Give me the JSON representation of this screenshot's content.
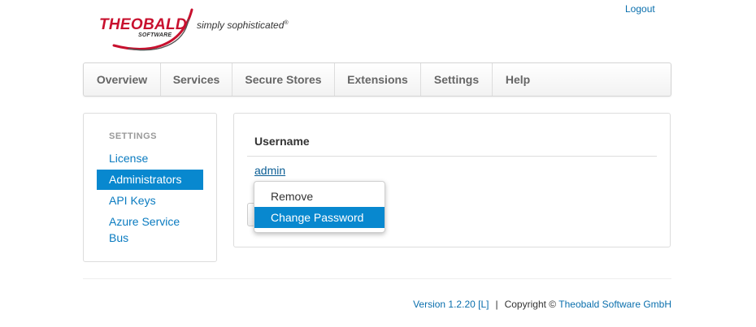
{
  "header": {
    "logo_word": "THEOBALD",
    "logo_sub": "SOFTWARE",
    "tagline": "simply sophisticated",
    "tagline_mark": "®",
    "logout_label": "Logout"
  },
  "nav": {
    "items": [
      {
        "label": "Overview"
      },
      {
        "label": "Services"
      },
      {
        "label": "Secure Stores"
      },
      {
        "label": "Extensions"
      },
      {
        "label": "Settings"
      },
      {
        "label": "Help"
      }
    ]
  },
  "sidebar": {
    "heading": "SETTINGS",
    "items": [
      {
        "label": "License",
        "active": false
      },
      {
        "label": "Administrators",
        "active": true
      },
      {
        "label": "API Keys",
        "active": false
      },
      {
        "label": "Azure Service",
        "active": false
      },
      {
        "label": "Bus",
        "active": false
      }
    ]
  },
  "main": {
    "column_header": "Username",
    "rows": [
      {
        "username": "admin"
      }
    ]
  },
  "context_menu": {
    "items": [
      {
        "label": "Remove",
        "highlighted": false
      },
      {
        "label": "Change Password",
        "highlighted": true
      }
    ]
  },
  "footer": {
    "version": "Version 1.2.20 [L]",
    "separator": "|",
    "copyright_prefix": "Copyright ©",
    "company": "Theobald Software GmbH"
  },
  "colors": {
    "brand_red": "#c8102e",
    "link_blue": "#0a7bc0",
    "active_blue": "#0888cf"
  }
}
